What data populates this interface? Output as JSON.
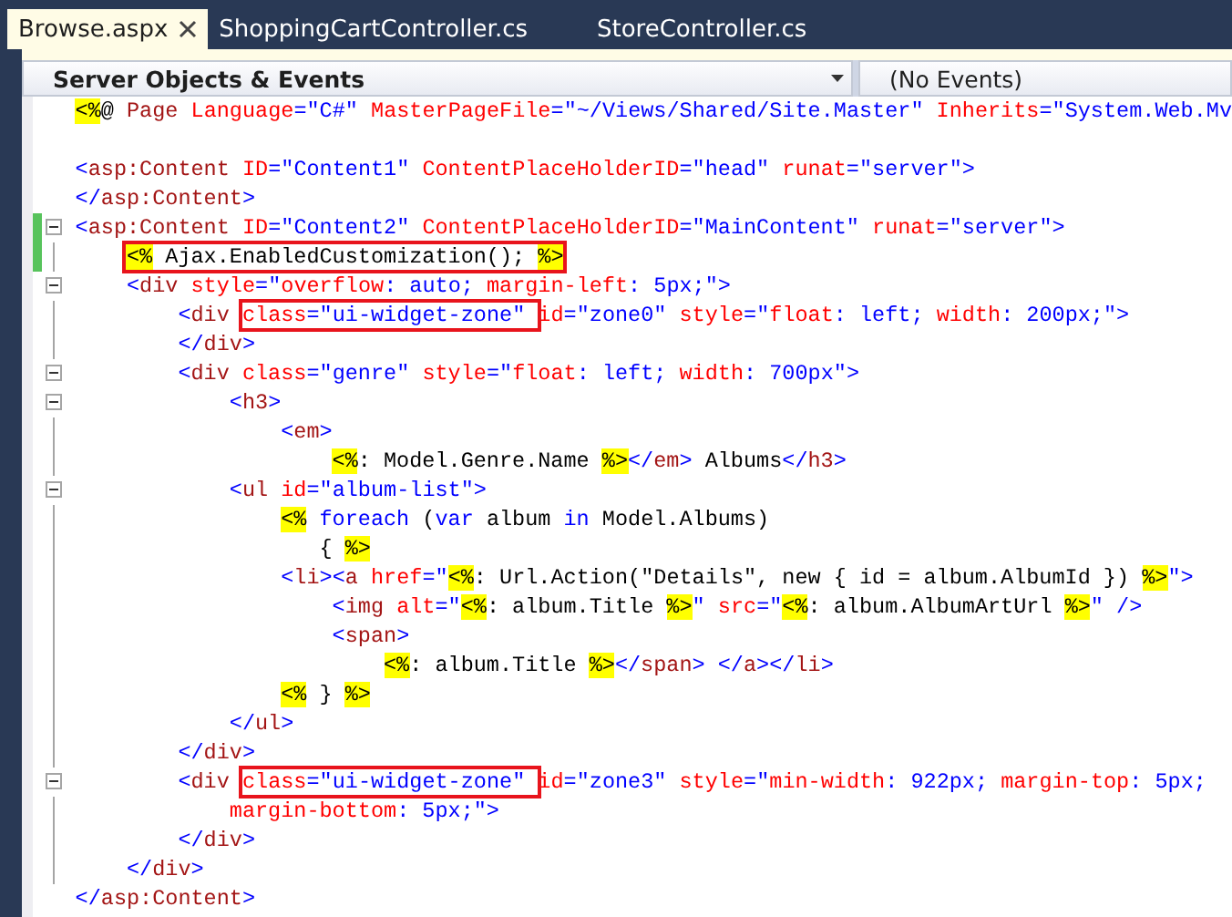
{
  "tabs": [
    {
      "label": "Browse.aspx",
      "selected": true
    },
    {
      "label": "ShoppingCartController.cs",
      "selected": false
    },
    {
      "label": "StoreController.cs",
      "selected": false
    }
  ],
  "toolbar": {
    "objects": "Server Objects & Events",
    "events": "(No Events)"
  },
  "lines": [
    {
      "blank_after": true,
      "tokens": [
        {
          "kind": "marker",
          "text": "<%"
        },
        {
          "kind": "plain",
          "text": "@ "
        },
        {
          "kind": "tag",
          "text": "Page"
        },
        {
          "kind": "attr",
          "text": " Language"
        },
        {
          "kind": "delim",
          "text": "="
        },
        {
          "kind": "value",
          "text": "\"C#\""
        },
        {
          "kind": "attr",
          "text": " MasterPageFile"
        },
        {
          "kind": "delim",
          "text": "="
        },
        {
          "kind": "value",
          "text": "\"~/Views/Shared/Site.Master\""
        },
        {
          "kind": "attr",
          "text": " Inherits"
        },
        {
          "kind": "delim",
          "text": "="
        },
        {
          "kind": "value",
          "text": "\"System.Web.Mv"
        }
      ]
    },
    {
      "tokens": [
        {
          "kind": "delim",
          "text": "<"
        },
        {
          "kind": "tag",
          "text": "asp:Content"
        },
        {
          "kind": "attr",
          "text": " ID"
        },
        {
          "kind": "delim",
          "text": "="
        },
        {
          "kind": "value",
          "text": "\"Content1\""
        },
        {
          "kind": "attr",
          "text": " ContentPlaceHolderID"
        },
        {
          "kind": "delim",
          "text": "="
        },
        {
          "kind": "value",
          "text": "\"head\""
        },
        {
          "kind": "attr",
          "text": " runat"
        },
        {
          "kind": "delim",
          "text": "="
        },
        {
          "kind": "value",
          "text": "\"server\""
        },
        {
          "kind": "delim",
          "text": ">"
        }
      ]
    },
    {
      "tokens": [
        {
          "kind": "delim",
          "text": "</"
        },
        {
          "kind": "tag",
          "text": "asp:Content"
        },
        {
          "kind": "delim",
          "text": ">"
        }
      ]
    },
    {
      "expanded": true,
      "changed": true,
      "tokens": [
        {
          "kind": "delim",
          "text": "<"
        },
        {
          "kind": "tag",
          "text": "asp:Content"
        },
        {
          "kind": "attr",
          "text": " ID"
        },
        {
          "kind": "delim",
          "text": "="
        },
        {
          "kind": "value",
          "text": "\"Content2\""
        },
        {
          "kind": "attr",
          "text": " ContentPlaceHolderID"
        },
        {
          "kind": "delim",
          "text": "="
        },
        {
          "kind": "value",
          "text": "\"MainContent\""
        },
        {
          "kind": "attr",
          "text": " runat"
        },
        {
          "kind": "delim",
          "text": "="
        },
        {
          "kind": "value",
          "text": "\"server\""
        },
        {
          "kind": "delim",
          "text": ">"
        }
      ],
      "children": [
        {
          "changed": true,
          "tokens": [
            {
              "kind": "callout",
              "tokens": [
                {
                  "kind": "marker",
                  "text": "<%"
                },
                {
                  "kind": "plain",
                  "text": " Ajax.EnabledCustomization(); "
                },
                {
                  "kind": "marker",
                  "text": "%>"
                }
              ]
            }
          ]
        },
        {
          "expanded": true,
          "tokens": [
            {
              "kind": "delim",
              "text": "<"
            },
            {
              "kind": "tag",
              "text": "div"
            },
            {
              "kind": "attr",
              "text": " style"
            },
            {
              "kind": "delim",
              "text": "="
            },
            {
              "kind": "value",
              "text": "\""
            },
            {
              "kind": "attr",
              "text": "overflow"
            },
            {
              "kind": "value",
              "text": ": auto;"
            },
            {
              "kind": "attr",
              "text": " margin-left"
            },
            {
              "kind": "value",
              "text": ": 5px;\""
            },
            {
              "kind": "delim",
              "text": ">"
            }
          ],
          "children": [
            {
              "tokens": [
                {
                  "kind": "delim",
                  "text": "<"
                },
                {
                  "kind": "tag",
                  "text": "div "
                },
                {
                  "kind": "callout",
                  "tokens": [
                    {
                      "kind": "attr",
                      "text": "class"
                    },
                    {
                      "kind": "delim",
                      "text": "="
                    },
                    {
                      "kind": "value",
                      "text": "\"ui-widget-zone\" "
                    }
                  ]
                },
                {
                  "kind": "attr",
                  "text": "id"
                },
                {
                  "kind": "delim",
                  "text": "="
                },
                {
                  "kind": "value",
                  "text": "\"zone0\""
                },
                {
                  "kind": "attr",
                  "text": " style"
                },
                {
                  "kind": "delim",
                  "text": "="
                },
                {
                  "kind": "value",
                  "text": "\""
                },
                {
                  "kind": "attr",
                  "text": "float"
                },
                {
                  "kind": "value",
                  "text": ": left;"
                },
                {
                  "kind": "attr",
                  "text": " width"
                },
                {
                  "kind": "value",
                  "text": ": 200px;\""
                },
                {
                  "kind": "delim",
                  "text": ">"
                }
              ]
            },
            {
              "tokens": [
                {
                  "kind": "delim",
                  "text": "</"
                },
                {
                  "kind": "tag",
                  "text": "div"
                },
                {
                  "kind": "delim",
                  "text": ">"
                }
              ]
            },
            {
              "expanded": true,
              "tokens": [
                {
                  "kind": "delim",
                  "text": "<"
                },
                {
                  "kind": "tag",
                  "text": "div"
                },
                {
                  "kind": "attr",
                  "text": " class"
                },
                {
                  "kind": "delim",
                  "text": "="
                },
                {
                  "kind": "value",
                  "text": "\"genre\""
                },
                {
                  "kind": "attr",
                  "text": " style"
                },
                {
                  "kind": "delim",
                  "text": "="
                },
                {
                  "kind": "value",
                  "text": "\""
                },
                {
                  "kind": "attr",
                  "text": "float"
                },
                {
                  "kind": "value",
                  "text": ": left;"
                },
                {
                  "kind": "attr",
                  "text": " width"
                },
                {
                  "kind": "value",
                  "text": ": 700px\""
                },
                {
                  "kind": "delim",
                  "text": ">"
                }
              ],
              "children": [
                {
                  "expanded": true,
                  "tokens": [
                    {
                      "kind": "delim",
                      "text": "<"
                    },
                    {
                      "kind": "tag",
                      "text": "h3"
                    },
                    {
                      "kind": "delim",
                      "text": ">"
                    }
                  ],
                  "children": [
                    {
                      "tokens": [
                        {
                          "kind": "delim",
                          "text": "<"
                        },
                        {
                          "kind": "tag",
                          "text": "em"
                        },
                        {
                          "kind": "delim",
                          "text": ">"
                        }
                      ],
                      "children": [
                        {
                          "tokens": [
                            {
                              "kind": "marker",
                              "text": "<%"
                            },
                            {
                              "kind": "plain",
                              "text": ": Model.Genre.Name "
                            },
                            {
                              "kind": "marker",
                              "text": "%>"
                            },
                            {
                              "kind": "delim",
                              "text": "</"
                            },
                            {
                              "kind": "tag",
                              "text": "em"
                            },
                            {
                              "kind": "delim",
                              "text": ">"
                            },
                            {
                              "kind": "plain",
                              "text": " Albums"
                            },
                            {
                              "kind": "delim",
                              "text": "</"
                            },
                            {
                              "kind": "tag",
                              "text": "h3"
                            },
                            {
                              "kind": "delim",
                              "text": ">"
                            }
                          ]
                        }
                      ]
                    }
                  ]
                },
                {
                  "expanded": true,
                  "tokens": [
                    {
                      "kind": "delim",
                      "text": "<"
                    },
                    {
                      "kind": "tag",
                      "text": "ul"
                    },
                    {
                      "kind": "attr",
                      "text": " id"
                    },
                    {
                      "kind": "delim",
                      "text": "="
                    },
                    {
                      "kind": "value",
                      "text": "\"album-list\""
                    },
                    {
                      "kind": "delim",
                      "text": ">"
                    }
                  ],
                  "children": [
                    {
                      "tokens": [
                        {
                          "kind": "marker",
                          "text": "<%"
                        },
                        {
                          "kind": "keyword",
                          "text": " foreach"
                        },
                        {
                          "kind": "plain",
                          "text": " ("
                        },
                        {
                          "kind": "keyword",
                          "text": "var"
                        },
                        {
                          "kind": "plain",
                          "text": " album "
                        },
                        {
                          "kind": "keyword",
                          "text": "in"
                        },
                        {
                          "kind": "plain",
                          "text": " Model.Albums)"
                        }
                      ]
                    },
                    {
                      "tokens": [
                        {
                          "kind": "plain",
                          "text": "   { "
                        },
                        {
                          "kind": "marker",
                          "text": "%>"
                        }
                      ]
                    },
                    {
                      "tokens": [
                        {
                          "kind": "delim",
                          "text": "<"
                        },
                        {
                          "kind": "tag",
                          "text": "li"
                        },
                        {
                          "kind": "delim",
                          "text": "><"
                        },
                        {
                          "kind": "tag",
                          "text": "a"
                        },
                        {
                          "kind": "attr",
                          "text": " href"
                        },
                        {
                          "kind": "delim",
                          "text": "=\""
                        },
                        {
                          "kind": "marker",
                          "text": "<%"
                        },
                        {
                          "kind": "plain",
                          "text": ": Url.Action(\"Details\", new { id = album.AlbumId }) "
                        },
                        {
                          "kind": "marker",
                          "text": "%>"
                        },
                        {
                          "kind": "delim",
                          "text": "\">"
                        }
                      ],
                      "children": [
                        {
                          "tokens": [
                            {
                              "kind": "delim",
                              "text": "<"
                            },
                            {
                              "kind": "tag",
                              "text": "img"
                            },
                            {
                              "kind": "attr",
                              "text": " alt"
                            },
                            {
                              "kind": "delim",
                              "text": "=\""
                            },
                            {
                              "kind": "marker",
                              "text": "<%"
                            },
                            {
                              "kind": "plain",
                              "text": ": album.Title "
                            },
                            {
                              "kind": "marker",
                              "text": "%>"
                            },
                            {
                              "kind": "delim",
                              "text": "\""
                            },
                            {
                              "kind": "attr",
                              "text": " src"
                            },
                            {
                              "kind": "delim",
                              "text": "=\""
                            },
                            {
                              "kind": "marker",
                              "text": "<%"
                            },
                            {
                              "kind": "plain",
                              "text": ": album.AlbumArtUrl "
                            },
                            {
                              "kind": "marker",
                              "text": "%>"
                            },
                            {
                              "kind": "delim",
                              "text": "\" />"
                            }
                          ]
                        },
                        {
                          "tokens": [
                            {
                              "kind": "delim",
                              "text": "<"
                            },
                            {
                              "kind": "tag",
                              "text": "span"
                            },
                            {
                              "kind": "delim",
                              "text": ">"
                            }
                          ],
                          "children": [
                            {
                              "tokens": [
                                {
                                  "kind": "marker",
                                  "text": "<%"
                                },
                                {
                                  "kind": "plain",
                                  "text": ": album.Title "
                                },
                                {
                                  "kind": "marker",
                                  "text": "%>"
                                },
                                {
                                  "kind": "delim",
                                  "text": "</"
                                },
                                {
                                  "kind": "tag",
                                  "text": "span"
                                },
                                {
                                  "kind": "delim",
                                  "text": "> </"
                                },
                                {
                                  "kind": "tag",
                                  "text": "a"
                                },
                                {
                                  "kind": "delim",
                                  "text": "></"
                                },
                                {
                                  "kind": "tag",
                                  "text": "li"
                                },
                                {
                                  "kind": "delim",
                                  "text": ">"
                                }
                              ]
                            }
                          ]
                        }
                      ]
                    },
                    {
                      "tokens": [
                        {
                          "kind": "marker",
                          "text": "<%"
                        },
                        {
                          "kind": "plain",
                          "text": " } "
                        },
                        {
                          "kind": "marker",
                          "text": "%>"
                        }
                      ]
                    }
                  ]
                },
                {
                  "tokens": [
                    {
                      "kind": "delim",
                      "text": "</"
                    },
                    {
                      "kind": "tag",
                      "text": "ul"
                    },
                    {
                      "kind": "delim",
                      "text": ">"
                    }
                  ]
                }
              ]
            },
            {
              "tokens": [
                {
                  "kind": "delim",
                  "text": "</"
                },
                {
                  "kind": "tag",
                  "text": "div"
                },
                {
                  "kind": "delim",
                  "text": ">"
                }
              ]
            },
            {
              "expanded": true,
              "tokens": [
                {
                  "kind": "delim",
                  "text": "<"
                },
                {
                  "kind": "tag",
                  "text": "div "
                },
                {
                  "kind": "callout",
                  "tokens": [
                    {
                      "kind": "attr",
                      "text": "class"
                    },
                    {
                      "kind": "delim",
                      "text": "="
                    },
                    {
                      "kind": "value",
                      "text": "\"ui-widget-zone\" "
                    }
                  ]
                },
                {
                  "kind": "attr",
                  "text": "id"
                },
                {
                  "kind": "delim",
                  "text": "="
                },
                {
                  "kind": "value",
                  "text": "\"zone3\""
                },
                {
                  "kind": "attr",
                  "text": " style"
                },
                {
                  "kind": "delim",
                  "text": "="
                },
                {
                  "kind": "value",
                  "text": "\""
                },
                {
                  "kind": "attr",
                  "text": "min-width"
                },
                {
                  "kind": "value",
                  "text": ": 922px;"
                },
                {
                  "kind": "attr",
                  "text": " margin-top"
                },
                {
                  "kind": "value",
                  "text": ": 5px;"
                }
              ],
              "children": [
                {
                  "tokens": [
                    {
                      "kind": "attr",
                      "text": "margin-bottom"
                    },
                    {
                      "kind": "value",
                      "text": ": 5px;\""
                    },
                    {
                      "kind": "delim",
                      "text": ">"
                    }
                  ]
                }
              ]
            },
            {
              "tokens": [
                {
                  "kind": "delim",
                  "text": "</"
                },
                {
                  "kind": "tag",
                  "text": "div"
                },
                {
                  "kind": "delim",
                  "text": ">"
                }
              ]
            }
          ]
        },
        {
          "tokens": [
            {
              "kind": "delim",
              "text": "</"
            },
            {
              "kind": "tag",
              "text": "div"
            },
            {
              "kind": "delim",
              "text": ">"
            }
          ]
        }
      ]
    },
    {
      "tokens": [
        {
          "kind": "delim",
          "text": "</"
        },
        {
          "kind": "tag",
          "text": "asp:Content"
        },
        {
          "kind": "delim",
          "text": ">"
        }
      ]
    }
  ]
}
